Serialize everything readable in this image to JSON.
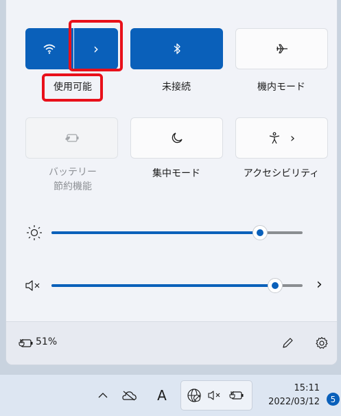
{
  "tiles": {
    "wifi": {
      "label": "使用可能",
      "icon": "wifi-icon"
    },
    "bluetooth": {
      "label": "未接続",
      "icon": "bluetooth-icon"
    },
    "airplane": {
      "label": "機内モード",
      "icon": "airplane-icon"
    },
    "battery_saver": {
      "label_line1": "バッテリー",
      "label_line2": "節約機能",
      "icon": "battery-saver-icon"
    },
    "focus": {
      "label": "集中モード",
      "icon": "moon-icon"
    },
    "accessibility": {
      "label": "アクセシビリティ",
      "icon": "accessibility-icon"
    }
  },
  "sliders": {
    "brightness": {
      "value_fraction": 0.83,
      "icon": "brightness-icon"
    },
    "volume": {
      "value_fraction": 0.89,
      "icon": "speaker-muted-icon"
    }
  },
  "footer": {
    "battery_text": "51%"
  },
  "taskbar": {
    "time": "15:11",
    "date": "2022/03/12",
    "notification_count": "5",
    "ime_indicator": "A"
  },
  "colors": {
    "accent": "#0a60ba",
    "highlight": "#e8101a"
  }
}
